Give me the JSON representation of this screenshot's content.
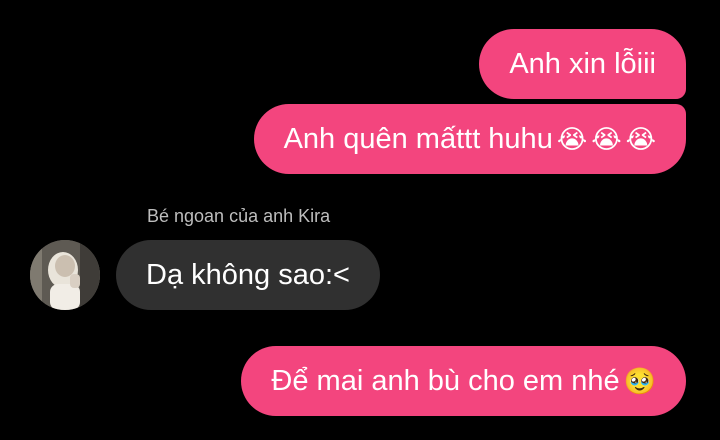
{
  "messages": [
    {
      "text": "Anh xin lỗiii",
      "emojis": []
    },
    {
      "text": "Anh quên mấttt huhu",
      "emojis": [
        "😭",
        "😭",
        "😭"
      ]
    },
    {
      "sender": "Bé ngoan của anh Kira",
      "text": "Dạ không sao:<"
    },
    {
      "text": "Để mai anh bù cho em nhé",
      "emojis": [
        "🥹"
      ]
    }
  ],
  "icons": {
    "crying": "loudly-crying-face-icon",
    "pleading": "face-holding-back-tears-icon"
  },
  "colors": {
    "background": "#000000",
    "outgoing_bubble": "#F3457E",
    "incoming_bubble": "#303030",
    "text": "#FFFFFF",
    "sender_name": "#BDBDBD"
  }
}
